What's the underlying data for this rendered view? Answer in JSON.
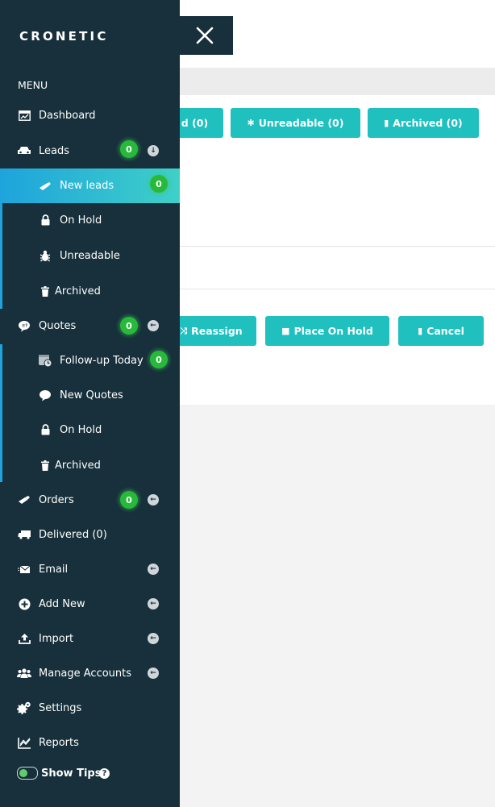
{
  "app": {
    "brand": "CRONETIC"
  },
  "menu": {
    "heading": "MENU",
    "dashboard": "Dashboard",
    "leads": {
      "label": "Leads",
      "count": "0"
    },
    "leads_sub": [
      {
        "label": "New leads",
        "count": "0"
      },
      {
        "label": "On Hold"
      },
      {
        "label": "Unreadable"
      },
      {
        "label": "Archived"
      }
    ],
    "quotes": {
      "label": "Quotes",
      "count": "0"
    },
    "quotes_sub": [
      {
        "label": "Follow-up Today",
        "count": "0"
      },
      {
        "label": "New Quotes"
      },
      {
        "label": "On Hold"
      },
      {
        "label": "Archived"
      }
    ],
    "orders": {
      "label": "Orders",
      "count": "0"
    },
    "delivered": "Delivered (0)",
    "email": "Email",
    "add_new": "Add New",
    "import": "Import",
    "manage_accounts": "Manage Accounts",
    "settings": "Settings",
    "reports": "Reports",
    "show_tips": "Show Tips"
  },
  "main": {
    "filter_buttons": [
      "d (0)",
      "Unreadable (0)",
      "Archived (0)"
    ],
    "action_buttons": [
      "Reassign",
      "Place On Hold",
      "Cancel"
    ]
  },
  "colors": {
    "sidebar": "#17303b",
    "accent": "#20c0bf",
    "badge": "#26b93a",
    "active_start": "#1ea4dc",
    "active_end": "#3fd0c8"
  }
}
